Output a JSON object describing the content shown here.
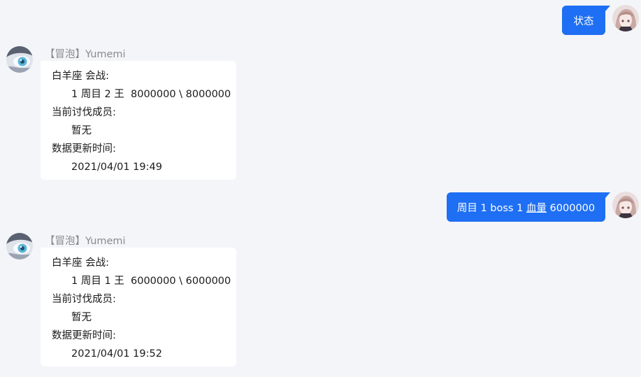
{
  "messages": [
    {
      "direction": "outgoing",
      "text": "状态"
    },
    {
      "direction": "incoming",
      "sender": "【冒泡】Yumemi",
      "lines": [
        "白羊座 会战:",
        "1 周目 2 王  8000000 \\ 8000000",
        "当前讨伐成员:",
        "暂无",
        "数据更新时间:",
        "2021/04/01 19:49"
      ]
    },
    {
      "direction": "outgoing",
      "text_parts": [
        "周目 1 boss 1 ",
        "血量",
        " 6000000"
      ]
    },
    {
      "direction": "incoming",
      "sender": "【冒泡】Yumemi",
      "lines": [
        "白羊座 会战:",
        "1 周目 1 王  6000000 \\ 6000000",
        "当前讨伐成员:",
        "暂无",
        "数据更新时间:",
        "2021/04/01 19:52"
      ]
    }
  ],
  "colors": {
    "background": "#f4f5f8",
    "outgoing_bubble": "#1e6ff3",
    "incoming_bubble": "#ffffff",
    "sender_name": "#8a8a8a"
  },
  "icons": {
    "user_avatar": "anime-girl-avatar",
    "bot_avatar": "anime-eye-avatar"
  }
}
